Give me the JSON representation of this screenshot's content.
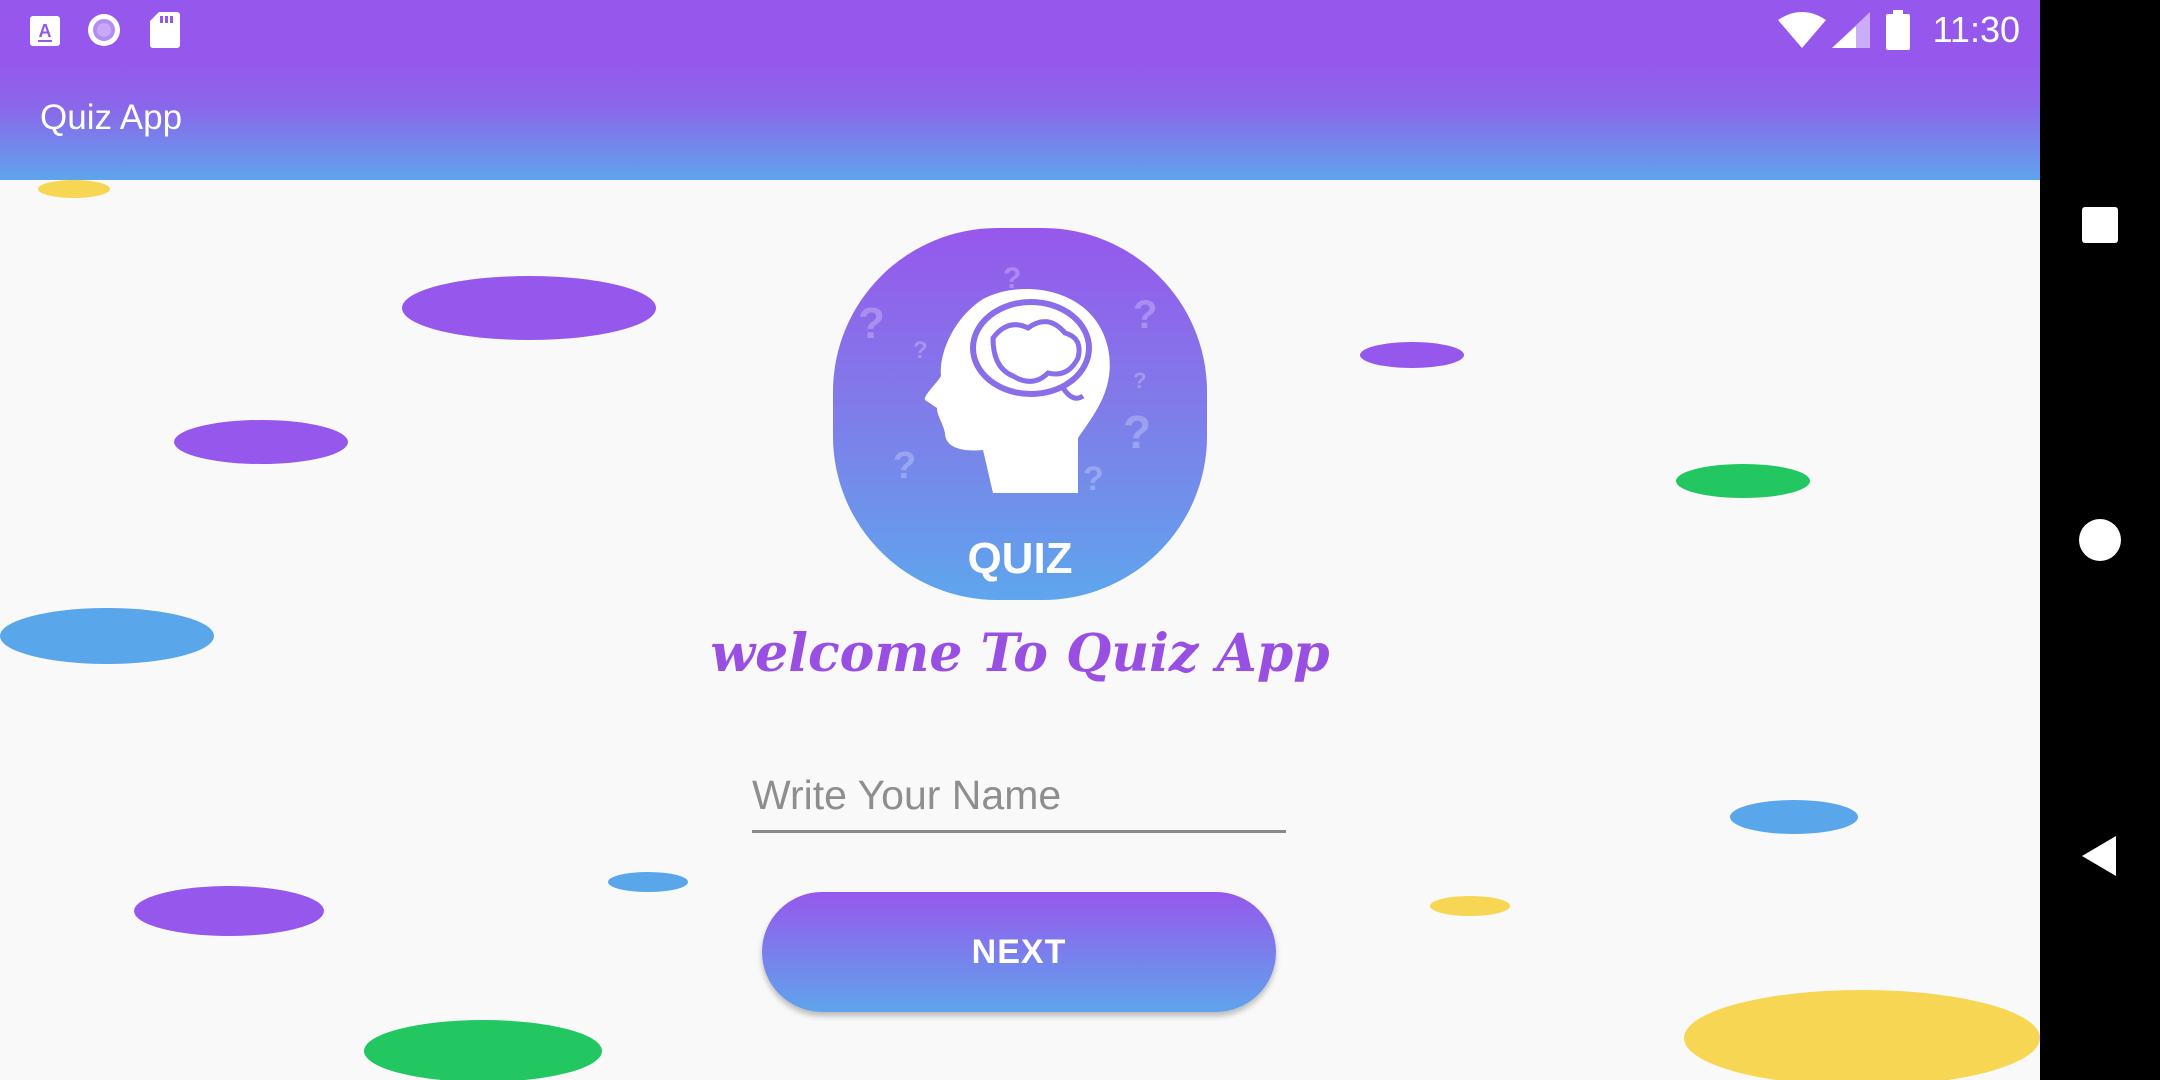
{
  "status_bar": {
    "time": "11:30",
    "left_icons": [
      "text-notification-icon",
      "record-icon",
      "sd-card-icon"
    ],
    "right_icons": [
      "wifi-icon",
      "cell-signal-icon",
      "battery-icon"
    ]
  },
  "app_bar": {
    "title": "Quiz App"
  },
  "logo": {
    "text": "QUIZ",
    "icon": "head-brain-icon"
  },
  "welcome": {
    "text": "welcome To Quiz App"
  },
  "name_field": {
    "value": "",
    "placeholder": "Write Your Name"
  },
  "next_button": {
    "label": "NEXT"
  },
  "nav_bar": {
    "icons": [
      "recents-square-icon",
      "home-circle-icon",
      "back-triangle-icon"
    ]
  },
  "colors": {
    "primary": "#9658EC",
    "gradient_end": "#5FA4EC",
    "blob_purple": "#9658EC",
    "blob_blue": "#5AA6EA",
    "blob_green": "#22C762",
    "blob_yellow": "#F7D653"
  }
}
